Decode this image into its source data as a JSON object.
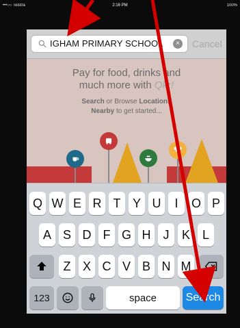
{
  "status_bar": {
    "carrier": "•••○○ Telstra",
    "wifi": "ᯤ",
    "time": "2:16 PM",
    "battery": "100%"
  },
  "search": {
    "value": "IGHAM PRIMARY SCHOOL",
    "cancel_label": "Cancel",
    "clear_symbol": "×"
  },
  "promo": {
    "line1": "Pay for food, drinks and",
    "line2_prefix": "much more with ",
    "line2_brand": "Qkr!",
    "line3_search": "Search",
    "line3_mid": " or Browse ",
    "line3_locations": "Locations",
    "line4_nearby": "Nearby",
    "line4_suffix": " to get started..."
  },
  "keyboard": {
    "row1": [
      "Q",
      "W",
      "E",
      "R",
      "T",
      "Y",
      "U",
      "I",
      "O",
      "P"
    ],
    "row2": [
      "A",
      "S",
      "D",
      "F",
      "G",
      "H",
      "J",
      "K",
      "L"
    ],
    "row3": [
      "Z",
      "X",
      "C",
      "V",
      "B",
      "N",
      "M"
    ],
    "row4": {
      "numbers": "123",
      "space": "space",
      "search": "Search"
    }
  },
  "annotation_color": "#d40000"
}
